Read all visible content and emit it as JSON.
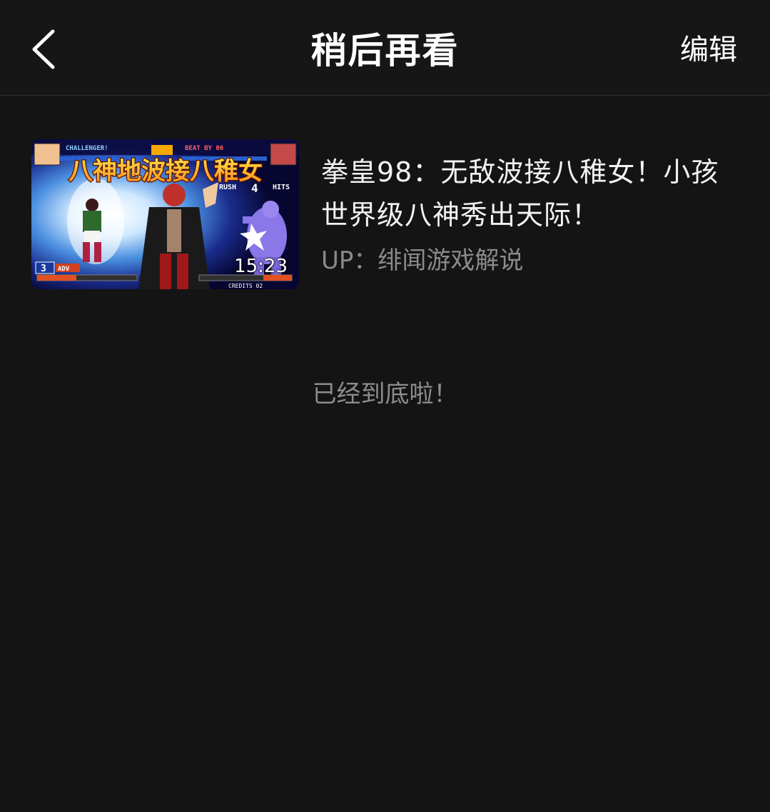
{
  "header": {
    "title": "稍后再看",
    "edit_label": "编辑",
    "back_icon": "chevron-left-icon"
  },
  "items": [
    {
      "title": "拳皇98：无敌波接八稚女！小孩世界级八神秀出天际！",
      "uploader": "UP：绯闻游戏解说",
      "duration": "15:23",
      "thumbnail": {
        "overlay_text": "八神地波接八稚女",
        "hud_challenger": "CHALLENGER!",
        "hud_beat_by": "BEAT BY 06",
        "hud_rush": "RUSH",
        "hud_hits": "HITS",
        "hud_combo": "4",
        "hud_stock": "3",
        "hud_adv": "ADV",
        "hud_credits": "CREDITS 02"
      }
    }
  ],
  "footer": {
    "end_text": "已经到底啦！"
  },
  "colors": {
    "background": "#141414",
    "header_background": "#161616",
    "title_text": "#ffffff",
    "secondary_text": "#8a8a8a"
  }
}
